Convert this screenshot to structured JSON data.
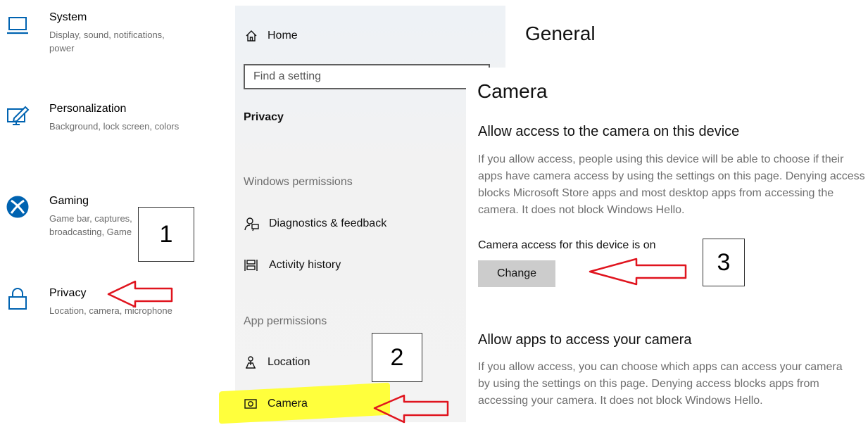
{
  "categories": [
    {
      "id": "system",
      "title": "System",
      "desc": "Display, sound, notifications, power",
      "icon": "laptop-icon"
    },
    {
      "id": "personalization",
      "title": "Personalization",
      "desc": "Background, lock screen, colors",
      "icon": "personalization-icon"
    },
    {
      "id": "gaming",
      "title": "Gaming",
      "desc": "Game bar, captures, broadcasting, Game",
      "icon": "xbox-icon"
    },
    {
      "id": "privacy",
      "title": "Privacy",
      "desc": "Location, camera, microphone",
      "icon": "lock-icon"
    }
  ],
  "nav": {
    "home_label": "Home",
    "search_placeholder": "Find a setting",
    "section_title": "Privacy",
    "groups": {
      "windows_permissions": "Windows permissions",
      "app_permissions": "App permissions"
    },
    "items": {
      "diagnostics": "Diagnostics & feedback",
      "activity": "Activity history",
      "location": "Location",
      "camera": "Camera"
    }
  },
  "right": {
    "general_heading": "General",
    "page_title": "Camera",
    "section1_heading": "Allow access to the camera on this device",
    "section1_body": "If you allow access, people using this device will be able to choose if their apps have camera access by using the settings on this page. Denying access blocks Microsoft Store apps and most desktop apps from accessing the camera. It does not block Windows Hello.",
    "status_text": "Camera access for this device is on",
    "change_button": "Change",
    "section2_heading": "Allow apps to access your camera",
    "section2_body": "If you allow access, you can choose which apps can access your camera by using the settings on this page. Denying access blocks apps from accessing your camera. It does not block Windows Hello."
  },
  "annotations": {
    "step1": "1",
    "step2": "2",
    "step3": "3",
    "arrow_color": "#e0141e",
    "highlight_color": "#ffff3c"
  },
  "accent_color": "#0063b1"
}
